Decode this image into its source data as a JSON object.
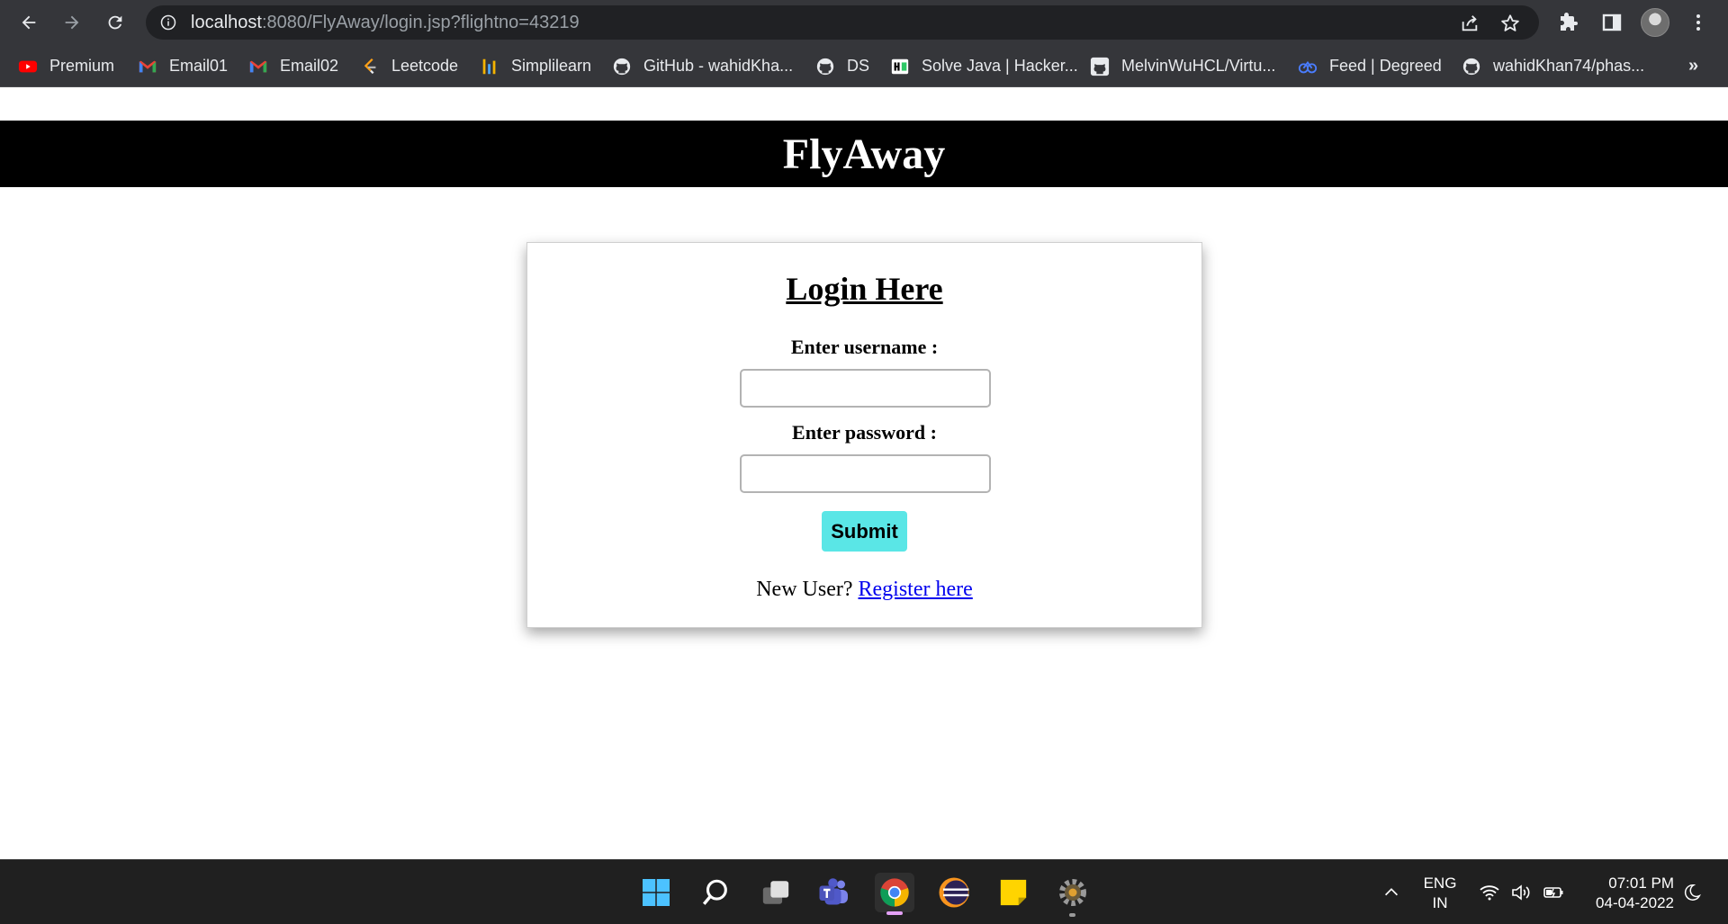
{
  "browser": {
    "url_host": "localhost",
    "url_rest": ":8080/FlyAway/login.jsp?flightno=43219",
    "bookmarks": [
      {
        "label": "Premium",
        "icon": "youtube-icon"
      },
      {
        "label": "Email01",
        "icon": "gmail-icon"
      },
      {
        "label": "Email02",
        "icon": "gmail-icon"
      },
      {
        "label": "Leetcode",
        "icon": "leetcode-icon"
      },
      {
        "label": "Simplilearn",
        "icon": "simplilearn-icon"
      },
      {
        "label": "GitHub - wahidKha...",
        "icon": "github-icon"
      },
      {
        "label": "DS",
        "icon": "github-icon"
      },
      {
        "label": "Solve Java | Hacker...",
        "icon": "hackerrank-icon"
      },
      {
        "label": "MelvinWuHCL/Virtu...",
        "icon": "github-icon"
      },
      {
        "label": "Feed | Degreed",
        "icon": "degreed-icon"
      },
      {
        "label": "wahidKhan74/phas...",
        "icon": "github-icon"
      }
    ],
    "more": "»"
  },
  "page": {
    "site_title": "FlyAway",
    "login": {
      "title": "Login Here",
      "username_label": "Enter username :",
      "password_label": "Enter password :",
      "username_value": "",
      "password_value": "",
      "submit_label": "Submit",
      "new_user_text": "New User? ",
      "register_link": "Register here"
    }
  },
  "taskbar": {
    "apps": [
      "start-icon",
      "search-icon",
      "task-view-icon",
      "teams-icon",
      "chrome-icon",
      "eclipse-icon",
      "sticky-notes-icon",
      "settings-icon"
    ],
    "lang_line1": "ENG",
    "lang_line2": "IN",
    "time": "07:01 PM",
    "date": "04-04-2022"
  },
  "colors": {
    "chrome_bg": "#35363a",
    "omnibox_bg": "#202124",
    "header_bg": "#000000",
    "submit_bg": "#5ae6e6",
    "link": "#0000ee",
    "taskbar_bg": "#202020"
  }
}
